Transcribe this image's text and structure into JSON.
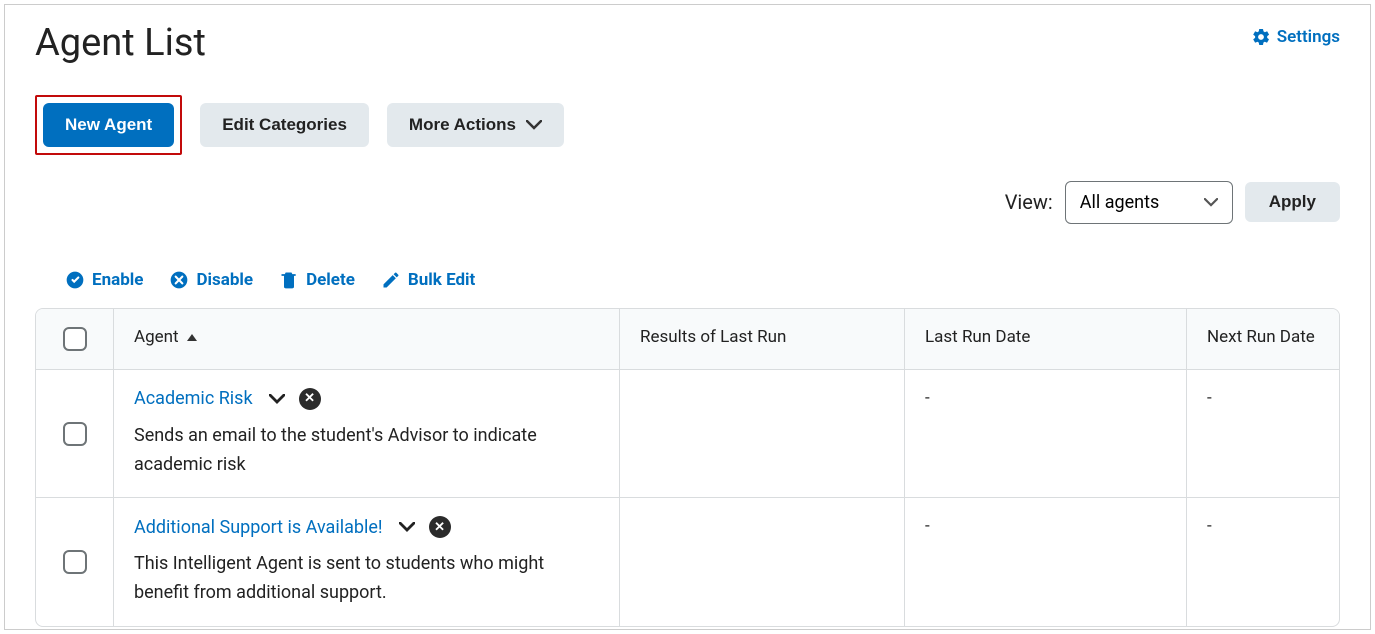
{
  "header": {
    "title": "Agent List",
    "settings_label": "Settings"
  },
  "toolbar": {
    "new_agent": "New Agent",
    "edit_categories": "Edit Categories",
    "more_actions": "More Actions"
  },
  "view": {
    "label": "View:",
    "selected": "All agents",
    "apply": "Apply"
  },
  "bulk": {
    "enable": "Enable",
    "disable": "Disable",
    "delete": "Delete",
    "bulk_edit": "Bulk Edit"
  },
  "table": {
    "columns": {
      "agent": "Agent",
      "results": "Results of Last Run",
      "last_date": "Last Run Date",
      "next_date": "Next Run Date"
    },
    "rows": [
      {
        "name": "Academic Risk",
        "desc": "Sends an email to the student's Advisor to indicate academic risk",
        "results": "",
        "last_date": "-",
        "next_date": "-"
      },
      {
        "name": "Additional Support is Available!",
        "desc": "This Intelligent Agent is sent to students who might benefit from additional support.",
        "results": "",
        "last_date": "-",
        "next_date": "-"
      }
    ]
  }
}
